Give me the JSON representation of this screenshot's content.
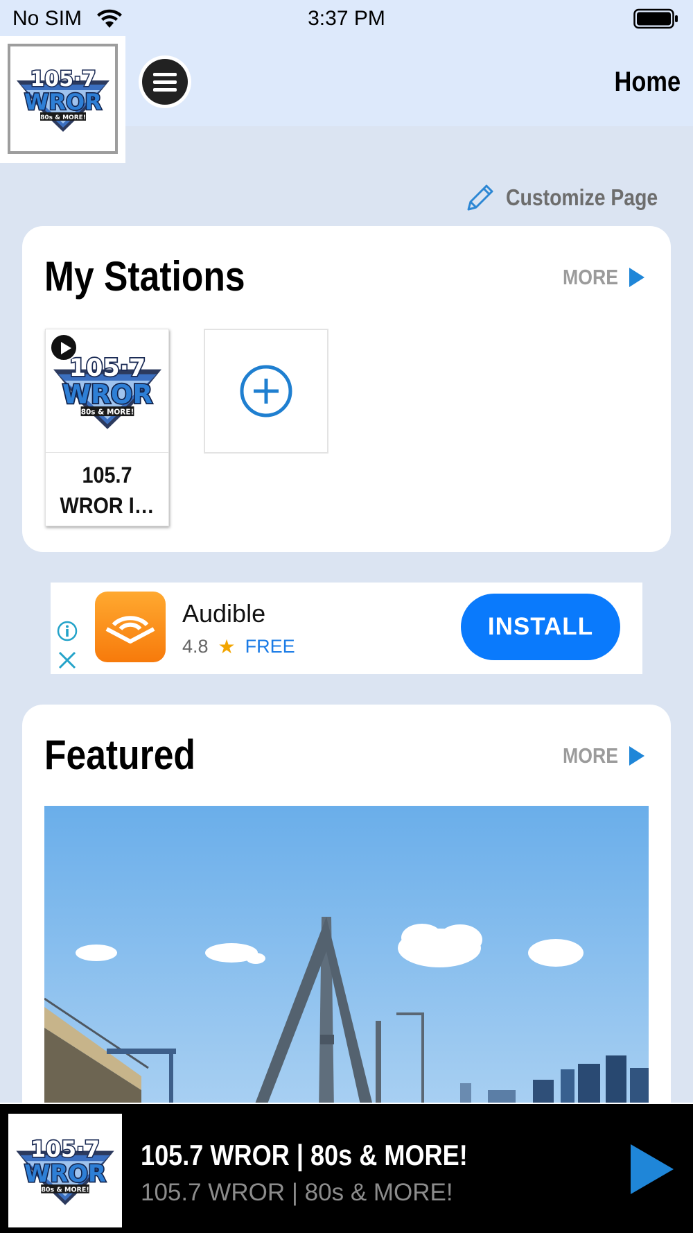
{
  "status_bar": {
    "carrier": "No SIM",
    "time": "3:37 PM"
  },
  "header": {
    "title": "Home",
    "logo_text": "105·7 WROR 80s & MORE!"
  },
  "customize": {
    "label": "Customize Page"
  },
  "my_stations": {
    "title": "My Stations",
    "more_label": "MORE",
    "stations": [
      {
        "name": "105.7 WROR I…"
      }
    ]
  },
  "ad": {
    "app_name": "Audible",
    "rating": "4.8",
    "price": "FREE",
    "cta": "INSTALL"
  },
  "featured": {
    "title": "Featured",
    "more_label": "MORE"
  },
  "player": {
    "title": "105.7 WROR | 80s & MORE!",
    "subtitle": "105.7 WROR | 80s & MORE!"
  },
  "colors": {
    "accent": "#1f86d8",
    "header_bg": "#dde9fb",
    "page_bg": "#dbe4f2",
    "install_blue": "#0a7afc"
  }
}
